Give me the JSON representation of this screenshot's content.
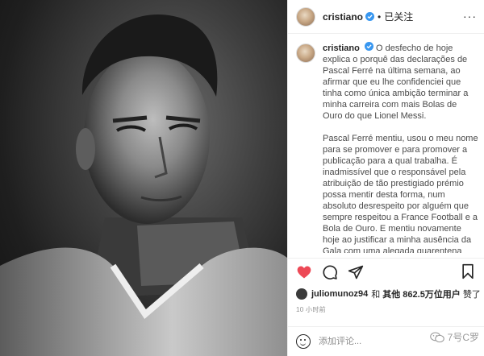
{
  "post": {
    "username": "cristiano",
    "separator": "•",
    "follow_status": "已关注",
    "more": "···"
  },
  "caption": {
    "username": "cristiano",
    "paragraph1": "O desfecho de hoje explica o porquê das declarações de Pascal Ferré na última semana, ao afirmar que eu lhe confidenciei que tinha como única ambição terminar a minha carreira com mais Bolas de Ouro do que Lionel Messi.",
    "paragraph2": "Pascal Ferré mentiu, usou o meu nome para se promover e para promover a publicação para a qual trabalha. É inadmissível que o responsável pela atribuição de tão prestigiado prémio possa mentir desta forma, num absoluto desrespeito por alguém que sempre respeitou a France Football e a Bola de Ouro. E mentiu novamente hoje ao justificar a minha ausência da Gala com uma alegada quarentena que não tem nenhuma razão de ser."
  },
  "likes": {
    "user": "juliomunoz94",
    "and": "和",
    "others_label": "其他",
    "count": "862.5万",
    "suffix": "位用户",
    "liked": "赞了"
  },
  "timestamp": "10 小时前",
  "comment": {
    "placeholder": "添加评论..."
  },
  "watermark": {
    "text": "7号C罗"
  },
  "colors": {
    "like_red": "#ed4956",
    "verified_blue": "#3897f0",
    "text": "#262626",
    "muted": "#8e8e8e"
  },
  "icons": [
    "verified-badge-icon",
    "more-icon",
    "heart-icon",
    "comment-icon",
    "share-icon",
    "bookmark-icon",
    "emoji-icon",
    "wechat-icon"
  ]
}
